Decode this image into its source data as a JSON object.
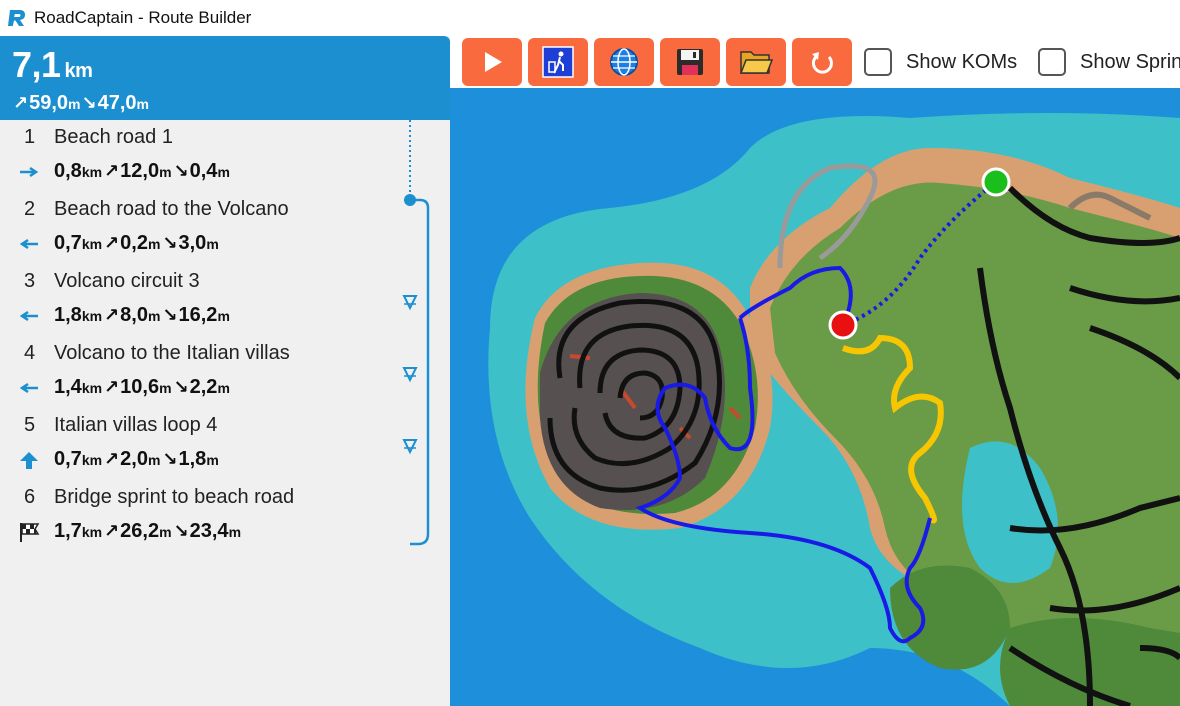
{
  "app": {
    "title": "RoadCaptain - Route Builder"
  },
  "summary": {
    "distance": "7,1",
    "distance_unit": "km",
    "ascent": "59,0",
    "ascent_unit": "m",
    "descent": "47,0",
    "descent_unit": "m"
  },
  "segments": [
    {
      "number": "1",
      "name": "Beach road 1",
      "icon": "arrow-right-icon",
      "distance": "0,8",
      "distance_unit": "km",
      "ascent": "12,0",
      "ascent_unit": "m",
      "descent": "0,4",
      "descent_unit": "m"
    },
    {
      "number": "2",
      "name": "Beach road to the Volcano",
      "icon": "arrow-left-icon",
      "distance": "0,7",
      "distance_unit": "km",
      "ascent": "0,2",
      "ascent_unit": "m",
      "descent": "3,0",
      "descent_unit": "m"
    },
    {
      "number": "3",
      "name": "Volcano circuit 3",
      "icon": "arrow-left-icon",
      "distance": "1,8",
      "distance_unit": "km",
      "ascent": "8,0",
      "ascent_unit": "m",
      "descent": "16,2",
      "descent_unit": "m"
    },
    {
      "number": "4",
      "name": "Volcano to the Italian villas",
      "icon": "arrow-left-icon",
      "distance": "1,4",
      "distance_unit": "km",
      "ascent": "10,6",
      "ascent_unit": "m",
      "descent": "2,2",
      "descent_unit": "m"
    },
    {
      "number": "5",
      "name": "Italian villas loop 4",
      "icon": "arrow-up-icon",
      "distance": "0,7",
      "distance_unit": "km",
      "ascent": "2,0",
      "ascent_unit": "m",
      "descent": "1,8",
      "descent_unit": "m"
    },
    {
      "number": "6",
      "name": "Bridge sprint to beach road",
      "icon": "finish-flag-icon",
      "distance": "1,7",
      "distance_unit": "km",
      "ascent": "26,2",
      "ascent_unit": "m",
      "descent": "23,4",
      "descent_unit": "m"
    }
  ],
  "toolbar": {
    "buttons": [
      {
        "name": "play-button",
        "icon": "play-icon"
      },
      {
        "name": "clear-route-button",
        "icon": "trash-icon"
      },
      {
        "name": "select-world-button",
        "icon": "globe-icon"
      },
      {
        "name": "save-button",
        "icon": "floppy-disk-icon"
      },
      {
        "name": "open-button",
        "icon": "folder-icon"
      },
      {
        "name": "reset-button",
        "icon": "undo-icon"
      }
    ],
    "show_koms_label": "Show KOMs",
    "show_sprints_label": "Show Sprints"
  },
  "colors": {
    "accent_blue": "#1b8fd0",
    "button_orange": "#f96a3e",
    "route_blue": "#1a1ae6",
    "route_yellow": "#f7c600",
    "start_marker": "#1bbf1b",
    "end_marker": "#e81010"
  }
}
